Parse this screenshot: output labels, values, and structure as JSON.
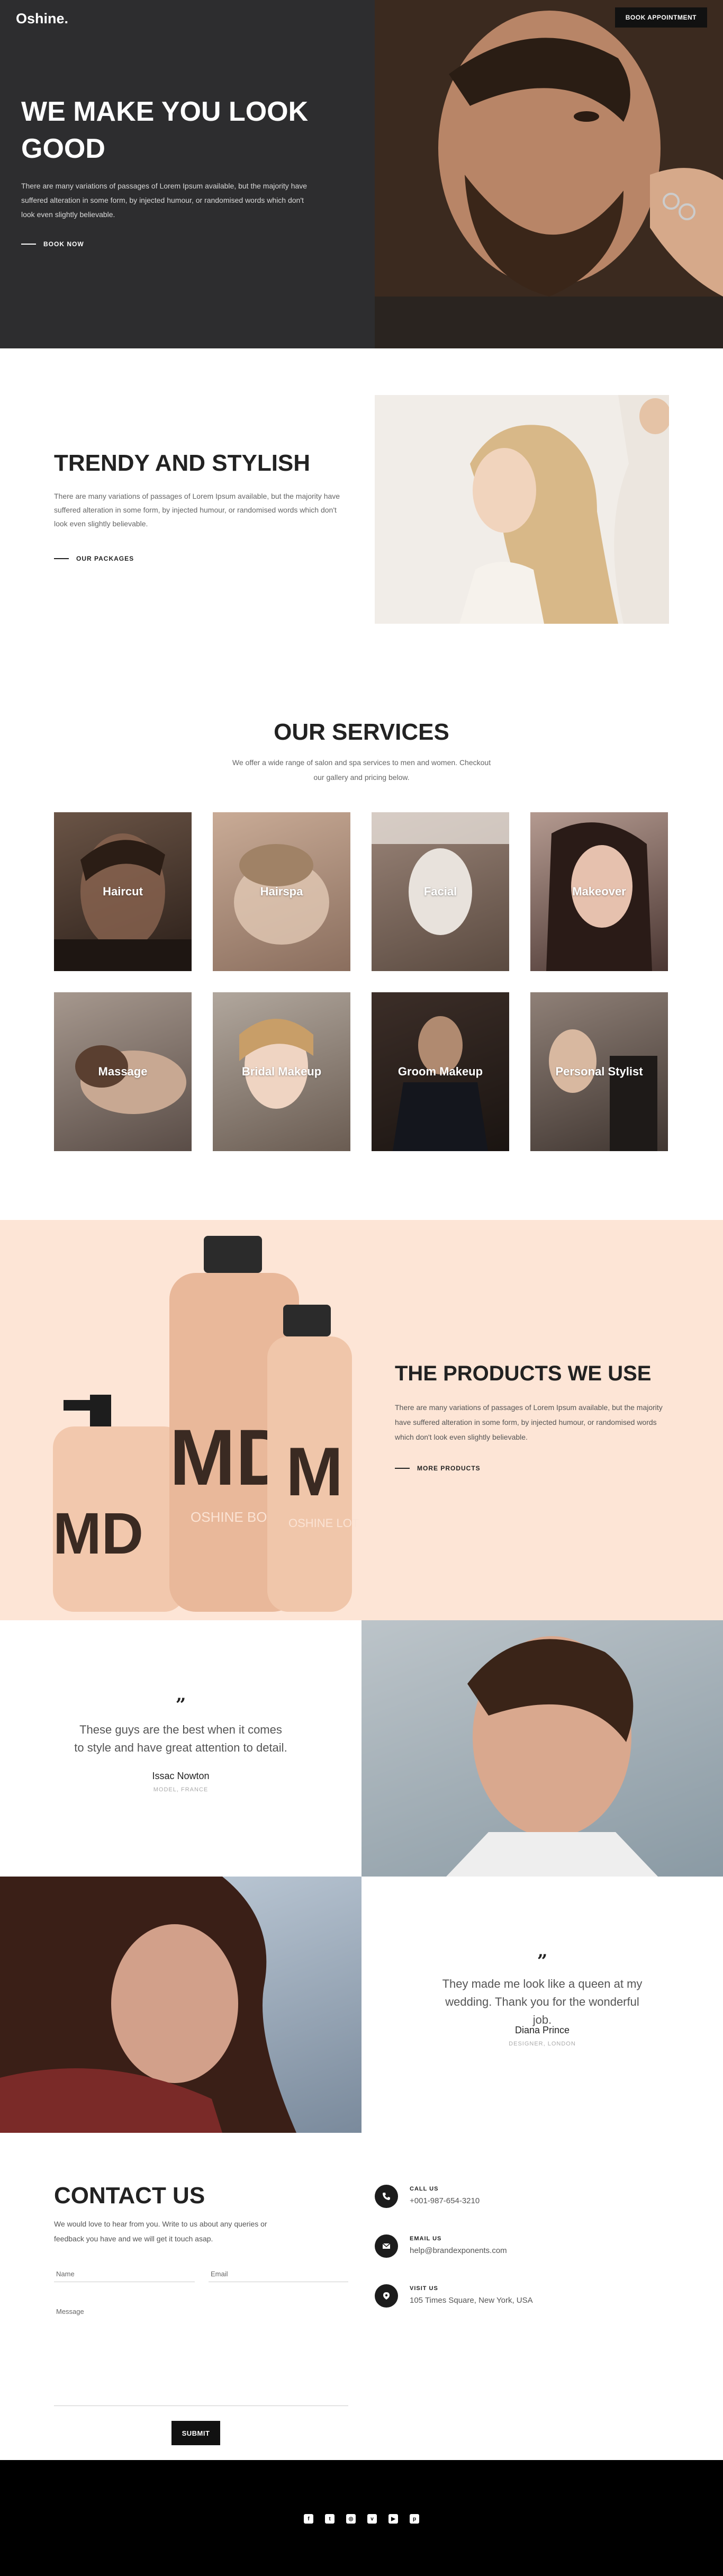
{
  "header": {
    "logo": "Oshine.",
    "book_button": "BOOK APPOINTMENT"
  },
  "hero": {
    "title": "WE MAKE YOU LOOK GOOD",
    "text": "There are many variations of passages of Lorem Ipsum available, but the majority have suffered alteration in some form, by injected humour, or randomised words which don't look even slightly believable.",
    "cta": "BOOK NOW"
  },
  "trendy": {
    "title": "TRENDY AND STYLISH",
    "text": "There are many variations of passages of Lorem Ipsum available, but the majority have suffered alteration in some form, by injected humour, or randomised words which don't look even slightly believable.",
    "cta": "OUR PACKAGES"
  },
  "services": {
    "title": "OUR SERVICES",
    "subtitle": "We offer a wide range of salon and spa services to men and women. Checkout our gallery and pricing below.",
    "items": [
      {
        "label": "Haircut"
      },
      {
        "label": "Hairspa"
      },
      {
        "label": "Facial"
      },
      {
        "label": "Makeover"
      },
      {
        "label": "Massage"
      },
      {
        "label": "Bridal Makeup"
      },
      {
        "label": "Groom Makeup"
      },
      {
        "label": "Personal Stylist"
      }
    ]
  },
  "products": {
    "title": "THE PRODUCTS WE USE",
    "text": "There are many variations of passages of Lorem Ipsum available, but the majority have suffered alteration in some form, by injected humour, or randomised words which don't look even slightly believable.",
    "cta": "MORE PRODUCTS",
    "bottle_text_1": "MD",
    "bottle_text_2": "MD",
    "bottle_text_3": "M",
    "bottle_label_2": "OSHINE BODY WASH",
    "bottle_label_3": "OSHINE LOTION"
  },
  "testimonials": [
    {
      "quote": "These guys are the best when it comes to style and have great attention to detail.",
      "name": "Issac Nowton",
      "role": "MODEL, FRANCE"
    },
    {
      "quote": "They made me look like a queen at my wedding. Thank you for the wonderful job.",
      "name": "Diana Prince",
      "role": "DESIGNER, LONDON"
    }
  ],
  "contact": {
    "title": "CONTACT US",
    "text": "We would love to hear from you. Write to us about any queries or feedback you have and we will get it touch asap.",
    "name_placeholder": "Name",
    "email_placeholder": "Email",
    "message_placeholder": "Message",
    "submit": "SUBMIT",
    "items": [
      {
        "label": "CALL US",
        "value": "+001-987-654-3210",
        "icon": "phone-icon"
      },
      {
        "label": "EMAIL US",
        "value": "help@brandexponents.com",
        "icon": "mail-icon"
      },
      {
        "label": "VISIT US",
        "value": "105 Times Square, New York, USA",
        "icon": "location-icon"
      }
    ]
  },
  "footer": {
    "social": [
      {
        "icon": "facebook-icon",
        "glyph": "f"
      },
      {
        "icon": "twitter-icon",
        "glyph": "t"
      },
      {
        "icon": "instagram-icon",
        "glyph": "◎"
      },
      {
        "icon": "vimeo-icon",
        "glyph": "v"
      },
      {
        "icon": "youtube-icon",
        "glyph": "▶"
      },
      {
        "icon": "pinterest-icon",
        "glyph": "p"
      }
    ]
  },
  "colors": {
    "dark": "#2d2d2f",
    "products_bg": "#fde5d6",
    "footer": "#000000"
  }
}
